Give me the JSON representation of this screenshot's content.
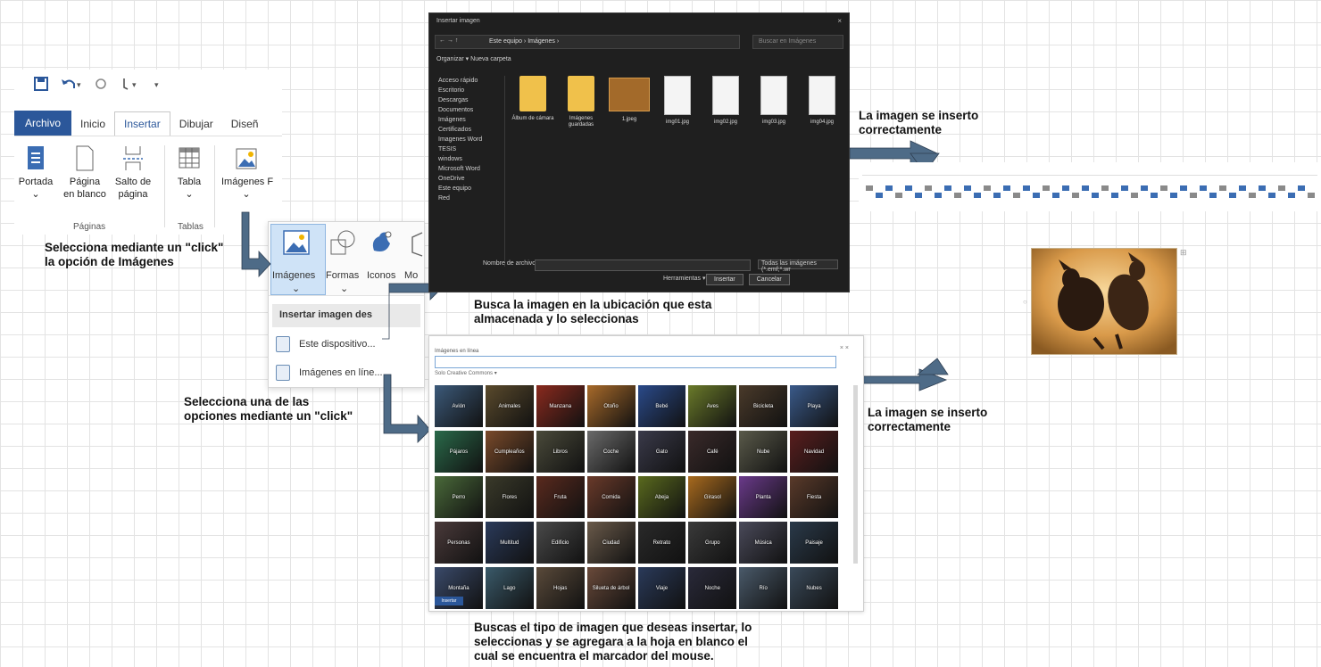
{
  "word_ribbon": {
    "tabs": [
      "Archivo",
      "Inicio",
      "Insertar",
      "Dibujar",
      "Diseñ"
    ],
    "buttons": {
      "portada": "Portada",
      "pagina_blanco_1": "Página",
      "pagina_blanco_2": "en blanco",
      "salto_1": "Salto de",
      "salto_2": "página",
      "tabla": "Tabla",
      "imagenes": "Imágenes",
      "f": "F"
    },
    "groups": {
      "paginas": "Páginas",
      "tablas": "Tablas"
    }
  },
  "images_menu": {
    "imagenes": "Imágenes",
    "formas": "Formas",
    "iconos": "Iconos",
    "mod": "Mo",
    "threeD": "3D",
    "header": "Insertar imagen des",
    "items": [
      "Este dispositivo...",
      "Imágenes en líne..."
    ]
  },
  "annotations": {
    "step1_line1": "Selecciona mediante un \"click\"",
    "step1_line2": "la opción de Imágenes",
    "step2_line1": "Selecciona una de las",
    "step2_line2": "opciones mediante un \"click\"",
    "step3_line1": "Busca la imagen en la ubicación que esta",
    "step3_line2": "almacenada y lo seleccionas",
    "step4_line1": "Buscas el tipo de imagen que deseas insertar, lo",
    "step4_line2": "seleccionas y se agregara a la hoja en blanco el",
    "step4_line3": "cual se encuentra el marcador del mouse.",
    "result_top_line1": "La imagen se inserto",
    "result_top_line2": "correctamente",
    "result_bottom_line1": "La imagen se inserto",
    "result_bottom_line2": "correctamente"
  },
  "file_dialog": {
    "title": "Insertar imagen",
    "close": "×",
    "address": "Este equipo › Imágenes ›",
    "search": "Buscar en Imágenes",
    "toolbar": "Organizar ▾    Nueva carpeta",
    "nav": [
      "Acceso rápido",
      "Escritorio",
      "Descargas",
      "Documentos",
      "Imágenes",
      "Certificados",
      "Imagenes Word",
      "TESIS",
      "windows",
      "Microsoft Word",
      "OneDrive",
      "Este equipo",
      "Red"
    ],
    "files": [
      {
        "name": "Álbum de cámara",
        "kind": "folder"
      },
      {
        "name": "Imágenes guardadas",
        "kind": "folder"
      },
      {
        "name": "1.jpeg",
        "kind": "image"
      },
      {
        "name": "img01.jpg",
        "kind": "doc"
      },
      {
        "name": "img02.jpg",
        "kind": "doc"
      },
      {
        "name": "img03.jpg",
        "kind": "doc"
      },
      {
        "name": "img04.jpg",
        "kind": "doc"
      }
    ],
    "filename_label": "Nombre de archivo:",
    "filetype": "Todas las imágenes (*.emf;*.wr",
    "tools": "Herramientas ▾",
    "insert": "Insertar",
    "cancel": "Cancelar"
  },
  "online_dialog": {
    "title": "Imágenes en línea",
    "close": "× ×",
    "creative_commons": "Solo Creative Commons ▾",
    "insert": "Insertar",
    "tiles": [
      "Avión",
      "Animales",
      "Manzana",
      "Otoño",
      "Bebé",
      "Aves",
      "Bicicleta",
      "Playa",
      "Pájaros",
      "Cumpleaños",
      "Libros",
      "Coche",
      "Gato",
      "Café",
      "Nube",
      "Navidad",
      "Perro",
      "Flores",
      "Fruta",
      "Comida",
      "Abeja",
      "Girasol",
      "Planta",
      "Fiesta",
      "Personas",
      "Multitud",
      "Edificio",
      "Ciudad",
      "Retrato",
      "Grupo",
      "Música",
      "Paisaje",
      "Montaña",
      "Lago",
      "Hojas",
      "Silueta de árbol",
      "Viaje",
      "Noche",
      "Río",
      "Nubes"
    ]
  },
  "colors": {
    "word_blue": "#2b579a",
    "arrow": "#4e6b87"
  }
}
